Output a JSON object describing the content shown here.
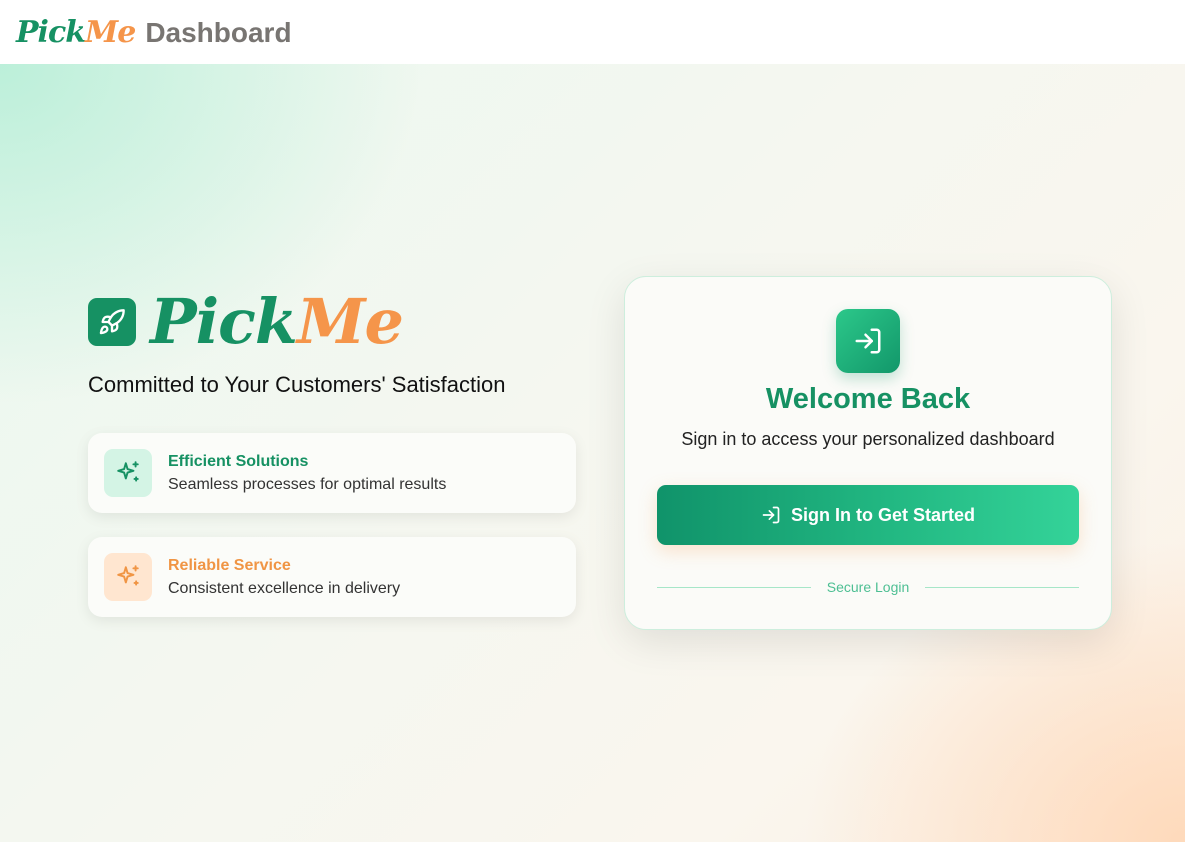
{
  "header": {
    "brand_pick": "Pick",
    "brand_me": "Me",
    "title": "Dashboard"
  },
  "hero": {
    "brand_pick": "Pick",
    "brand_me": "Me",
    "tagline": "Committed to Your Customers' Satisfaction",
    "features": [
      {
        "title": "Efficient Solutions",
        "description": "Seamless processes for optimal results",
        "icon": "sparkles-icon",
        "accent": "#169163"
      },
      {
        "title": "Reliable Service",
        "description": "Consistent excellence in delivery",
        "icon": "sparkles-icon",
        "accent": "#f09544"
      }
    ]
  },
  "login_card": {
    "icon": "log-in-icon",
    "title": "Welcome Back",
    "subtitle": "Sign in to access your personalized dashboard",
    "button_label": "Sign In to Get Started",
    "divider_label": "Secure Login"
  },
  "colors": {
    "primary_green": "#169163",
    "accent_orange": "#f5954a"
  }
}
